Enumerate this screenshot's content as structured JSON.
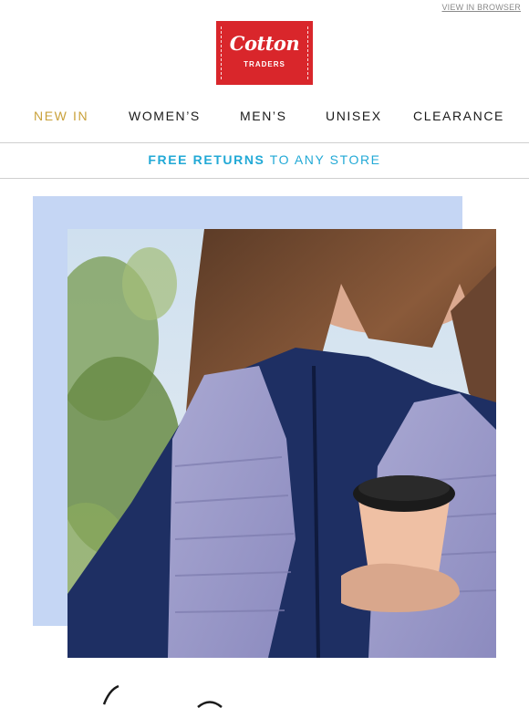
{
  "header": {
    "view_in_browser": "VIEW IN BROWSER",
    "logo_word": "Cotton",
    "logo_sub": "TRADERS"
  },
  "nav": {
    "items": [
      {
        "label": "NEW IN"
      },
      {
        "label": "WOMEN’S"
      },
      {
        "label": "MEN’S"
      },
      {
        "label": "UNISEX"
      },
      {
        "label": "CLEARANCE"
      }
    ]
  },
  "promo": {
    "bold": "FREE RETURNS",
    "rest": " TO ANY STORE"
  },
  "colors": {
    "brand_red": "#d9262b",
    "accent_gold": "#c9a13a",
    "promo_blue": "#22a9d6",
    "backdrop_blue": "#c5d6f4"
  }
}
